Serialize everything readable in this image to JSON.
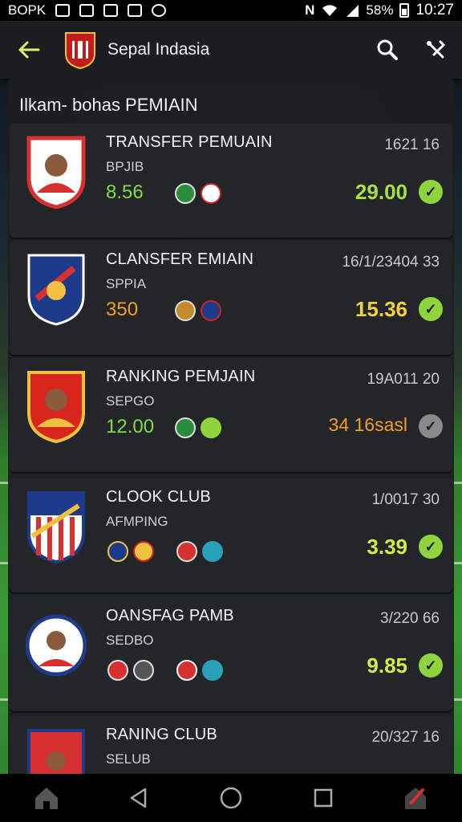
{
  "status_bar": {
    "carrier": "BOPK",
    "battery": "58%",
    "time": "10:27"
  },
  "app_bar": {
    "title": "Sepal Indasia",
    "icons": [
      "back-arrow-icon",
      "club-logo",
      "search-icon",
      "tools-icon"
    ]
  },
  "section": {
    "title": "Ilkam- bohas PEMIAIN"
  },
  "cards": [
    {
      "name": "TRANSFER PEMUAIN",
      "sub": "BPJIB",
      "value": "8.56",
      "meta": "1621 16",
      "score": "29.00",
      "value_color": "#7fdc45",
      "score_color": "#a8e040",
      "check_color": "#8fd43c"
    },
    {
      "name": "CLANSFER EMIAIN",
      "sub": "SPPIA",
      "value": "350",
      "meta": "16/1/23404 33",
      "score": "15.36",
      "value_color": "#f0a020",
      "score_color": "#f2d23a",
      "check_color": "#8fd43c"
    },
    {
      "name": "RANKING PEMJAIN",
      "sub": "SEPGO",
      "value": "12.00",
      "meta": "19A011 20",
      "score": "34 16sasl",
      "value_color": "#7fdc45",
      "score_color": "#f0a020",
      "check_color": "#8a8a8a"
    },
    {
      "name": "CLOOK CLUB",
      "sub": "AFMPING",
      "value": "",
      "meta": "1/0017 30",
      "score": "3.39",
      "value_color": "#7fdc45",
      "score_color": "#d4ec40",
      "check_color": "#8fd43c"
    },
    {
      "name": "OANSFAG PAMB",
      "sub": "SEDBO",
      "value": "",
      "meta": "3/220 66",
      "score": "9.85",
      "value_color": "#7fdc45",
      "score_color": "#d4ec40",
      "check_color": "#8fd43c"
    },
    {
      "name": "RANING CLUB",
      "sub": "SELUB",
      "value": "",
      "meta": "20/327 16",
      "score": "",
      "value_color": "#7fdc45",
      "score_color": "#d4ec40",
      "check_color": "#8fd43c"
    }
  ],
  "nav_bar": {
    "icons": [
      "home-icon",
      "back-triangle-icon",
      "home-circle-icon",
      "recents-square-icon",
      "shortcut-icon"
    ]
  }
}
